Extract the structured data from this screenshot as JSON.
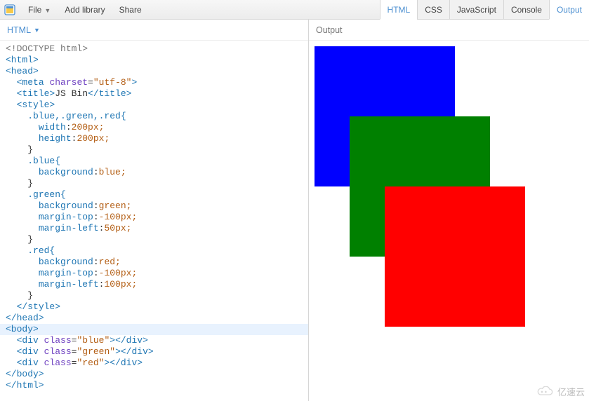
{
  "toolbar": {
    "file_label": "File",
    "addlib_label": "Add library",
    "share_label": "Share",
    "panel_html": "HTML",
    "panel_css": "CSS",
    "panel_js": "JavaScript",
    "panel_console": "Console",
    "panel_output": "Output"
  },
  "panes": {
    "editor_title": "HTML",
    "output_title": "Output"
  },
  "editor": {
    "highlight_line_index": 25,
    "lines": [
      {
        "t": "doctype",
        "txt": "<!DOCTYPE html>"
      },
      {
        "t": "tag-open",
        "name": "html"
      },
      {
        "t": "tag-open",
        "name": "head"
      },
      {
        "t": "meta",
        "indent": 1,
        "name": "meta",
        "attr": "charset",
        "val": "utf-8"
      },
      {
        "t": "tag-text",
        "indent": 1,
        "name": "title",
        "text": "JS Bin"
      },
      {
        "t": "tag-open",
        "indent": 1,
        "name": "style"
      },
      {
        "t": "css-sel",
        "indent": 2,
        "sel": ".blue,.green,.red{"
      },
      {
        "t": "css-decl",
        "indent": 3,
        "prop": "width",
        "val": "200",
        "unit": "px;"
      },
      {
        "t": "css-decl",
        "indent": 3,
        "prop": "height",
        "val": "200",
        "unit": "px;"
      },
      {
        "t": "css-close",
        "indent": 2
      },
      {
        "t": "css-sel",
        "indent": 2,
        "sel": ".blue{"
      },
      {
        "t": "css-decl",
        "indent": 3,
        "prop": "background",
        "val": "blue",
        "unit": ";"
      },
      {
        "t": "css-close",
        "indent": 2
      },
      {
        "t": "css-sel",
        "indent": 2,
        "sel": ".green{"
      },
      {
        "t": "css-decl",
        "indent": 3,
        "prop": "background",
        "val": "green",
        "unit": ";"
      },
      {
        "t": "css-decl",
        "indent": 3,
        "prop": "margin-top",
        "val": "-100",
        "unit": "px;"
      },
      {
        "t": "css-decl",
        "indent": 3,
        "prop": "margin-left",
        "val": "50",
        "unit": "px;"
      },
      {
        "t": "css-close",
        "indent": 2
      },
      {
        "t": "css-sel",
        "indent": 2,
        "sel": ".red{"
      },
      {
        "t": "css-decl",
        "indent": 3,
        "prop": "background",
        "val": "red",
        "unit": ";"
      },
      {
        "t": "css-decl",
        "indent": 3,
        "prop": "margin-top",
        "val": "-100",
        "unit": "px;"
      },
      {
        "t": "css-decl",
        "indent": 3,
        "prop": "margin-left",
        "val": "100",
        "unit": "px;"
      },
      {
        "t": "css-close",
        "indent": 2
      },
      {
        "t": "tag-close",
        "indent": 1,
        "name": "style"
      },
      {
        "t": "tag-close",
        "name": "head"
      },
      {
        "t": "tag-open",
        "name": "body"
      },
      {
        "t": "div",
        "indent": 1,
        "cls": "blue"
      },
      {
        "t": "div",
        "indent": 1,
        "cls": "green"
      },
      {
        "t": "div",
        "indent": 1,
        "cls": "red"
      },
      {
        "t": "tag-close",
        "name": "body"
      },
      {
        "t": "tag-close",
        "name": "html"
      }
    ]
  },
  "output": {
    "squares": [
      {
        "color": "blue"
      },
      {
        "color": "green"
      },
      {
        "color": "red"
      }
    ]
  },
  "watermark": "亿速云"
}
